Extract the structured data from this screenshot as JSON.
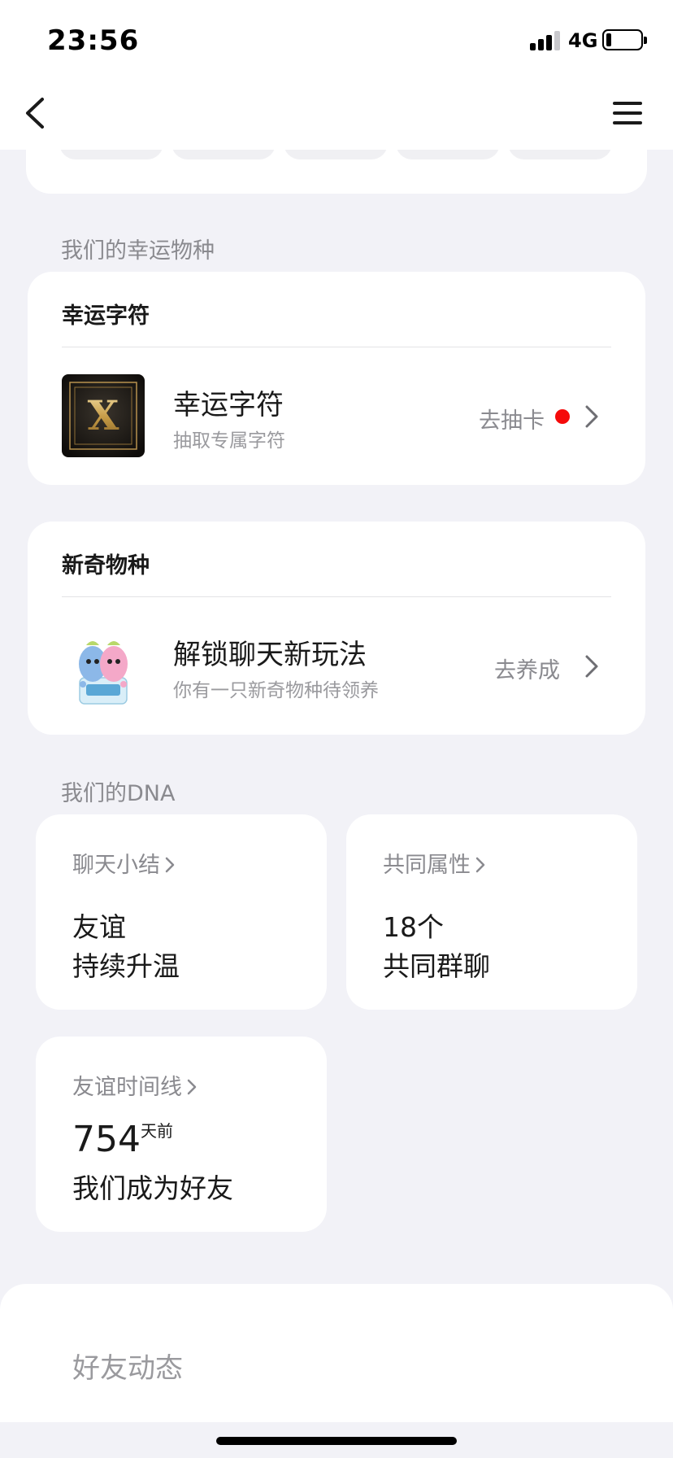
{
  "status_bar": {
    "time": "23:56",
    "network": "4G",
    "battery_level": 0.15
  },
  "nav": {
    "back_icon": "chevron-left-icon",
    "menu_icon": "hamburger-menu-icon"
  },
  "lucky_section": {
    "label": "我们的幸运物种",
    "card_title": "幸运字符",
    "item_title": "幸运字符",
    "item_subtitle": "抽取专属字符",
    "action": "去抽卡",
    "icon": "letter-x-tile-icon",
    "icon_letter": "X",
    "dot_color": "#F50A0A"
  },
  "novel_section": {
    "card_title": "新奇物种",
    "item_title": "解锁聊天新玩法",
    "item_subtitle": "你有一只新奇物种待领养",
    "action": "去养成",
    "icon": "pet-creatures-icon"
  },
  "dna_section": {
    "label": "我们的DNA",
    "cards": [
      {
        "header": "聊天小结",
        "line1": "友谊",
        "line2": "持续升温"
      },
      {
        "header": "共同属性",
        "line1": "18个",
        "line2": "共同群聊"
      },
      {
        "header": "友谊时间线",
        "number": "754",
        "unit": "天前",
        "line2": "我们成为好友"
      }
    ]
  },
  "feed": {
    "title": "好友动态"
  },
  "colors": {
    "background": "#F2F2F7",
    "card": "#FFFFFF",
    "secondary_text": "#8A8A8F",
    "accent_red": "#F50A0A"
  }
}
